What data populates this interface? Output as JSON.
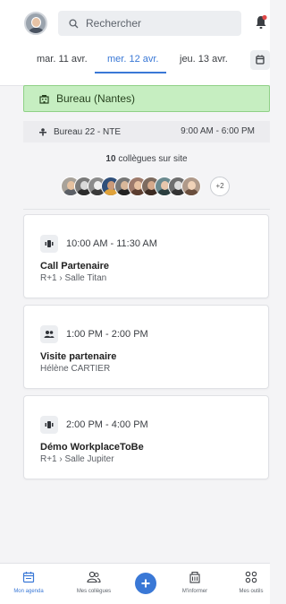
{
  "header": {
    "search_placeholder": "Rechercher",
    "dates": [
      {
        "label": "mar. 11 avr.",
        "active": false
      },
      {
        "label": "mer. 12 avr.",
        "active": true
      },
      {
        "label": "jeu. 13 avr.",
        "active": false
      }
    ]
  },
  "workplace": {
    "banner_label": "Bureau (Nantes)",
    "office_name": "Bureau 22 - NTE",
    "office_hours": "9:00 AM - 6:00 PM",
    "colleagues_count": "10",
    "colleagues_text": "collègues sur site",
    "more_count": "+2"
  },
  "events": [
    {
      "time": "10:00 AM - 11:30 AM",
      "title": "Call Partenaire",
      "subtitle": "R+1 › Salle Titan",
      "icon": "room-icon"
    },
    {
      "time": "1:00 PM - 2:00 PM",
      "title": "Visite partenaire",
      "subtitle": "Hélène CARTIER",
      "icon": "people-icon"
    },
    {
      "time": "2:00 PM - 4:00 PM",
      "title": "Démo WorkplaceToBe",
      "subtitle": "R+1 › Salle Jupiter",
      "icon": "room-icon"
    }
  ],
  "nav": {
    "agenda": "Mon agenda",
    "colleagues": "Mes collègues",
    "inform": "M'informer",
    "tools": "Mes outils"
  },
  "colors": {
    "accent": "#3a78d6",
    "banner_bg": "#c6eec1",
    "banner_border": "#8fd186"
  }
}
